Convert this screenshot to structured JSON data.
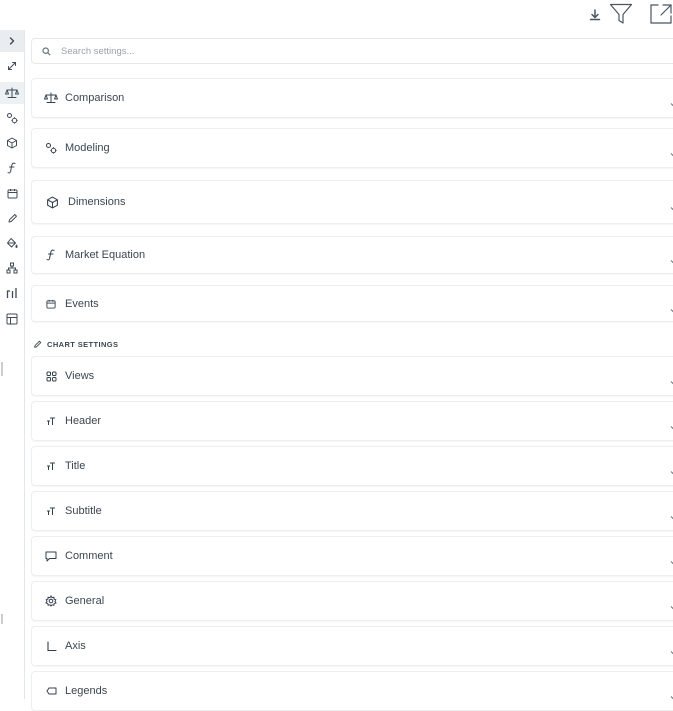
{
  "search": {
    "placeholder": "Search settings..."
  },
  "panels": [
    {
      "label": "Comparison",
      "icon": "scale-icon"
    },
    {
      "label": "Modeling",
      "icon": "gears-icon"
    },
    {
      "label": "Dimensions",
      "icon": "cube-icon"
    },
    {
      "label": "Market Equation",
      "icon": "function-icon"
    },
    {
      "label": "Events",
      "icon": "calendar-icon"
    }
  ],
  "chart_settings": {
    "title": "CHART SETTINGS",
    "panels": [
      {
        "label": "Views",
        "icon": "grid-icon"
      },
      {
        "label": "Header",
        "icon": "text-size-icon"
      },
      {
        "label": "Title",
        "icon": "text-size-icon"
      },
      {
        "label": "Subtitle",
        "icon": "text-size-icon"
      },
      {
        "label": "Comment",
        "icon": "comment-icon"
      },
      {
        "label": "General",
        "icon": "gear-icon"
      },
      {
        "label": "Axis",
        "icon": "axis-icon"
      },
      {
        "label": "Legends",
        "icon": "legend-icon"
      }
    ]
  },
  "rail": [
    "chevron-right-icon",
    "expand-icon",
    "scale-icon",
    "gears-icon",
    "cube-icon",
    "function-icon",
    "calendar-icon",
    "pencil-icon",
    "paint-bucket-icon",
    "hierarchy-icon",
    "bars-icon",
    "table-icon"
  ],
  "toolbar": [
    "download-icon",
    "filter-icon",
    "fullscreen-icon"
  ]
}
